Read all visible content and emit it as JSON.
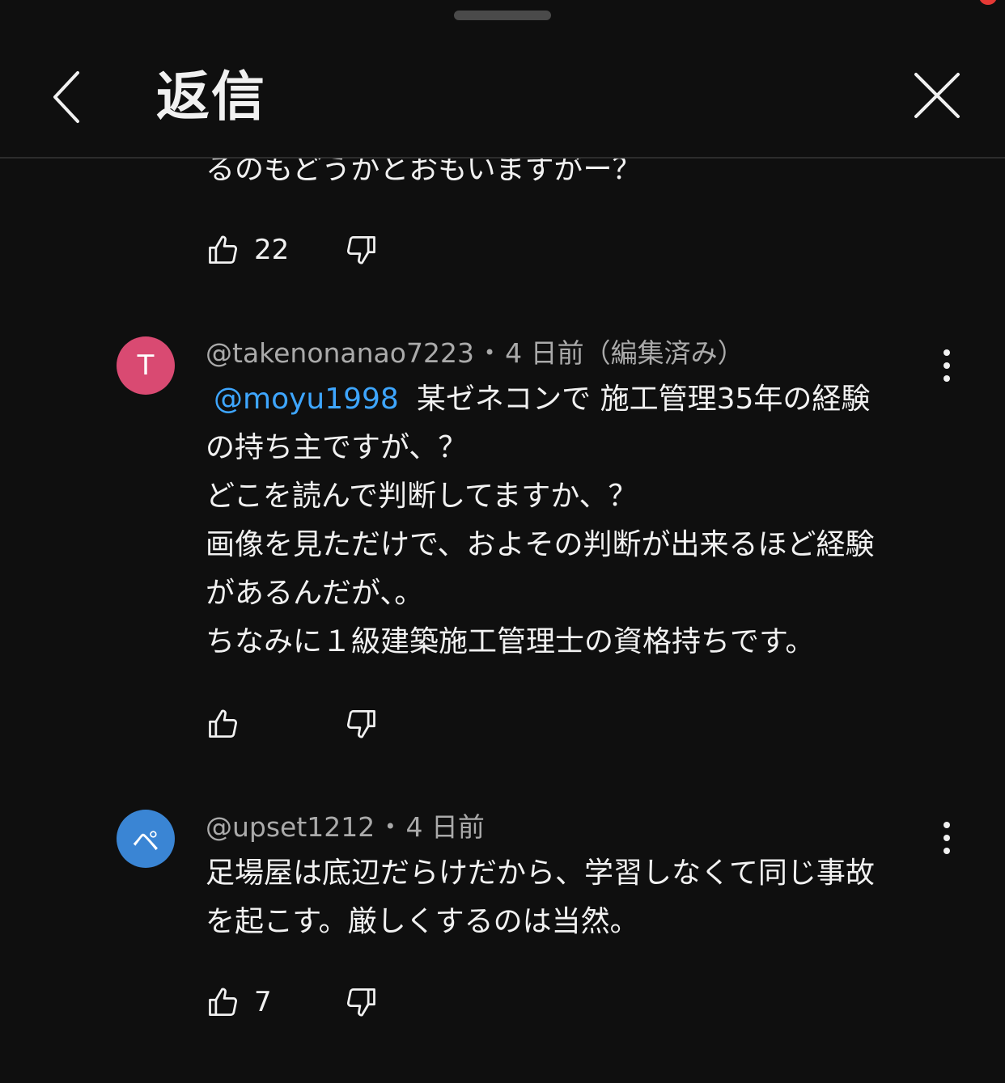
{
  "header": {
    "title": "返信",
    "back_icon": "chevron-left-icon",
    "close_icon": "close-icon"
  },
  "colors": {
    "background": "#0f0f0f",
    "mention": "#3ea6ff",
    "avatar_t": "#d94a72",
    "avatar_pe": "#3a85d4",
    "notification": "#e53935"
  },
  "partial_comment": {
    "text_tail": "るのもどうかとおもいますがー？",
    "likes": "22"
  },
  "comments": [
    {
      "avatar_letter": "T",
      "handle": "@takenonanao7223",
      "separator": "•",
      "time": "4 日前（編集済み）",
      "mention": "@moyu1998",
      "lines": [
        "某ゼネコンで 施工管理35年の経験",
        "の持ち主ですが、？",
        "どこを読んで判断してますか、？",
        "画像を見ただけで、およその判断が出来るほど経験",
        "があるんだが、。",
        "ちなみに１級建築施工管理士の資格持ちです。"
      ],
      "likes": ""
    },
    {
      "avatar_letter": "ペ",
      "handle": "@upset1212",
      "separator": "•",
      "time": "4 日前",
      "lines": [
        "足場屋は底辺だらけだから、学習しなくて同じ事故",
        "を起こす。厳しくするのは当然。"
      ],
      "likes": "7"
    }
  ]
}
